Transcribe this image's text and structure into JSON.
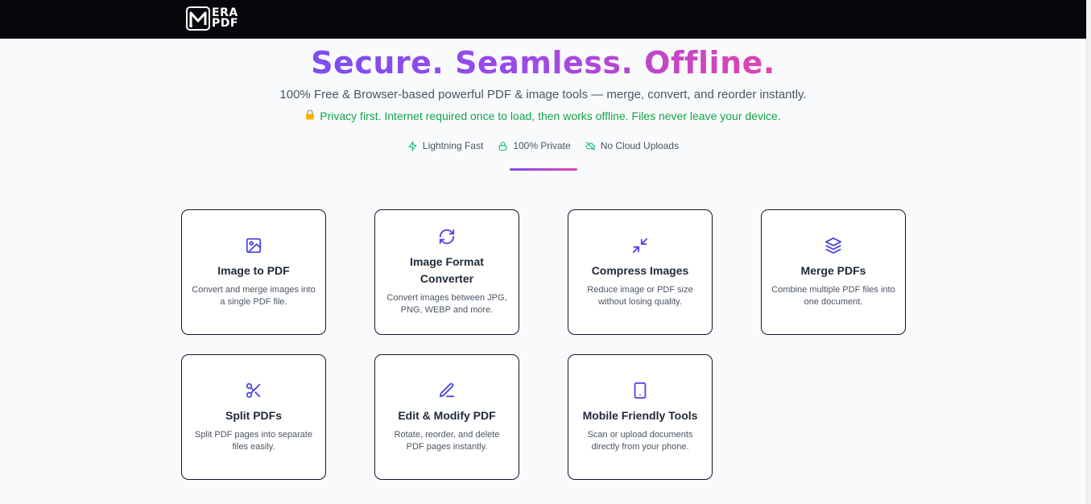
{
  "header": {
    "logo_top": "ERA",
    "logo_bottom": "PDF"
  },
  "hero": {
    "title": "Secure. Seamless. Offline.",
    "subtitle": "100% Free & Browser-based powerful PDF & image tools — merge, convert, and reorder instantly.",
    "privacy": "Privacy first. Internet required once to load, then works offline. Files never leave your device.",
    "privacy_icon": "lock-icon",
    "accent_gradient": [
      "#7c4df0",
      "#e044b0"
    ],
    "privacy_color": "#16a34a"
  },
  "badges": [
    {
      "label": "Lightning Fast",
      "icon": "lightning-icon"
    },
    {
      "label": "100% Private",
      "icon": "lock-icon"
    },
    {
      "label": "No Cloud Uploads",
      "icon": "cloud-off-icon"
    }
  ],
  "tools": [
    {
      "title": "Image to PDF",
      "desc": "Convert and merge images into a single PDF file.",
      "icon": "image-icon"
    },
    {
      "title": "Image Format Converter",
      "desc": "Convert images between JPG, PNG, WEBP and more.",
      "icon": "refresh-icon"
    },
    {
      "title": "Compress Images",
      "desc": "Reduce image or PDF size without losing quality.",
      "icon": "compress-icon"
    },
    {
      "title": "Merge PDFs",
      "desc": "Combine multiple PDF files into one document.",
      "icon": "layers-icon"
    },
    {
      "title": "Split PDFs",
      "desc": "Split PDF pages into separate files easily.",
      "icon": "scissors-icon"
    },
    {
      "title": "Edit & Modify PDF",
      "desc": "Rotate, reorder, and delete PDF pages instantly.",
      "icon": "pen-icon"
    },
    {
      "title": "Mobile Friendly Tools",
      "desc": "Scan or upload documents directly from your phone.",
      "icon": "smartphone-icon"
    }
  ],
  "icon_color": "#4f46e5"
}
